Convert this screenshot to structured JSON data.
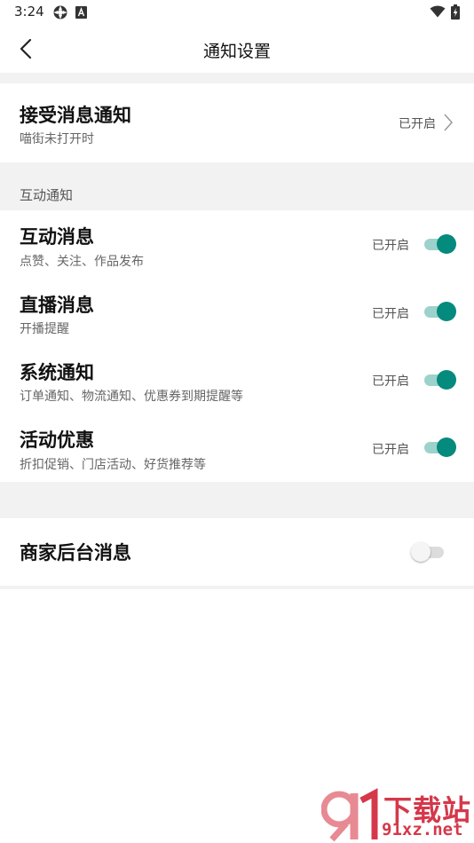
{
  "status_bar": {
    "time": "3:24",
    "icons": [
      "settings-gear-icon",
      "app-a-icon",
      "wifi-icon",
      "battery-charging-icon"
    ]
  },
  "header": {
    "title": "通知设置",
    "back_icon": "chevron-left-icon"
  },
  "receive": {
    "title": "接受消息通知",
    "subtitle": "喵街未打开时",
    "status": "已开启"
  },
  "interaction_section": {
    "label": "互动通知",
    "items": [
      {
        "title": "互动消息",
        "subtitle": "点赞、关注、作品发布",
        "status": "已开启",
        "enabled": true
      },
      {
        "title": "直播消息",
        "subtitle": "开播提醒",
        "status": "已开启",
        "enabled": true
      },
      {
        "title": "系统通知",
        "subtitle": "订单通知、物流通知、优惠券到期提醒等",
        "status": "已开启",
        "enabled": true
      },
      {
        "title": "活动优惠",
        "subtitle": "折扣促销、门店活动、好货推荐等",
        "status": "已开启",
        "enabled": true
      }
    ]
  },
  "merchant": {
    "title": "商家后台消息",
    "enabled": false
  },
  "watermark": {
    "title": "下载站",
    "url": "91xz.net"
  },
  "colors": {
    "accent": "#058a7e",
    "accent_track": "#9cd2cb",
    "section_bg": "#f2f2f2",
    "watermark": "#d5384a"
  }
}
